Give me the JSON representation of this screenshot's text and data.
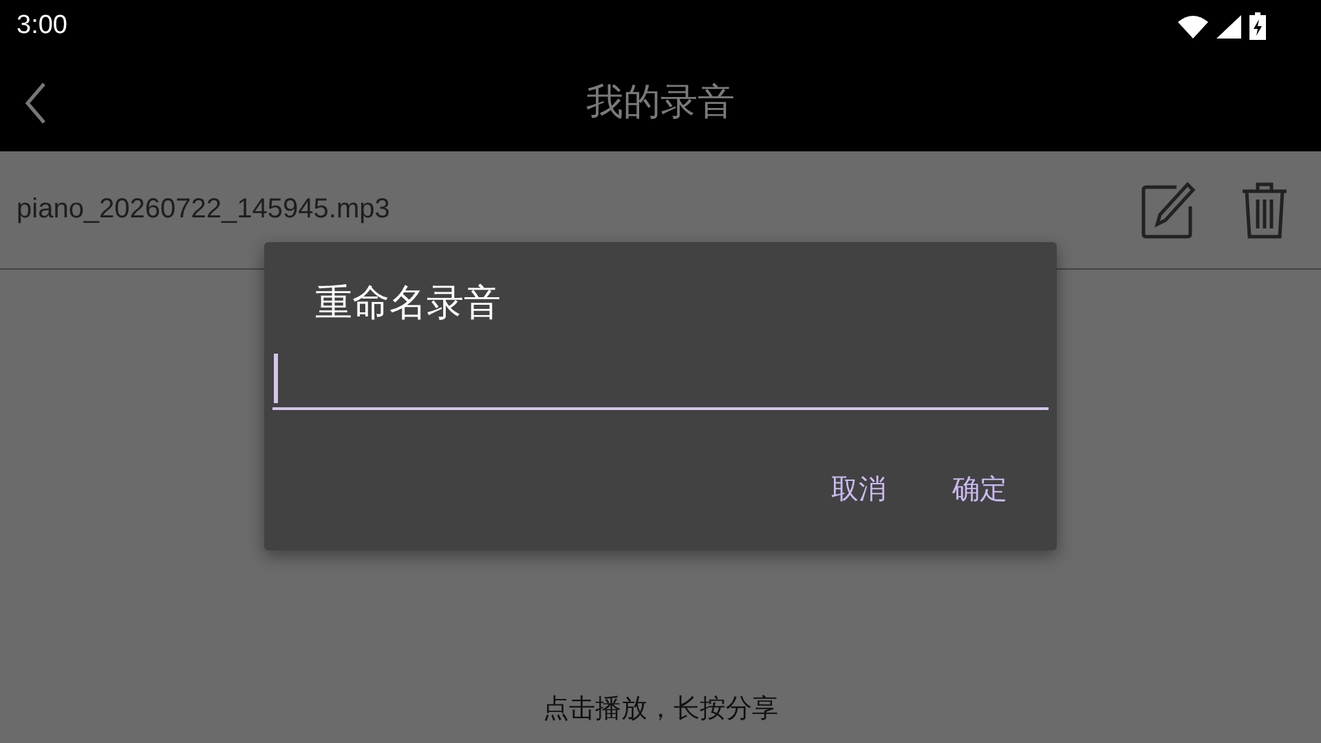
{
  "status_bar": {
    "time": "3:00"
  },
  "app_bar": {
    "title": "我的录音"
  },
  "recordings": [
    {
      "name": "piano_20260722_145945.mp3"
    }
  ],
  "dialog": {
    "title": "重命名录音",
    "buttons": [
      "取消",
      "确定"
    ]
  },
  "footer": {
    "hint": "点击播放，长按分享"
  }
}
